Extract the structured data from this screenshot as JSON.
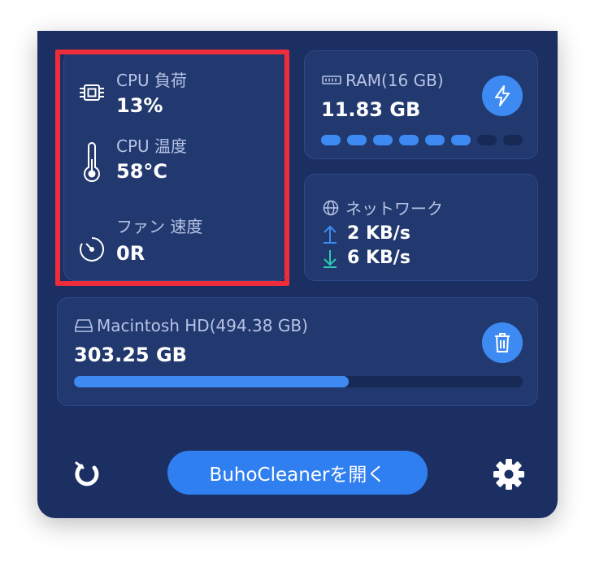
{
  "cpu_card": {
    "load_label": "CPU 負荷",
    "load_value": "13%",
    "temp_label": "CPU 温度",
    "temp_value": "58°C",
    "fan_label": "ファン 速度",
    "fan_value": "0R"
  },
  "ram_card": {
    "label": "RAM(16 GB)",
    "value": "11.83 GB",
    "usage_fraction": 0.74,
    "segments_total": 8,
    "segments_filled": 6
  },
  "network_card": {
    "label": "ネットワーク",
    "upload": "2 KB/s",
    "download": "6 KB/s"
  },
  "disk_card": {
    "label": "Macintosh HD(494.38 GB)",
    "value": "303.25 GB",
    "usage_fraction": 0.613
  },
  "footer": {
    "open_button_label": "BuhoCleanerを開く"
  },
  "icons": {
    "cpu": "cpu-chip-icon",
    "temperature": "thermometer-icon",
    "fan": "gauge-icon",
    "ram": "memory-module-icon",
    "boost": "lightning-icon",
    "network": "globe-icon",
    "upload": "arrow-up-icon",
    "download": "arrow-down-icon",
    "disk": "hard-drive-icon",
    "trash": "trash-icon",
    "logo": "buho-logo-icon",
    "settings": "gear-icon"
  },
  "colors": {
    "panel_bg": "#1c2f63",
    "card_bg": "#22396f",
    "accent": "#3d8bf2",
    "upload_arrow": "#3d8bf2",
    "download_arrow": "#2ec9b0",
    "highlight": "#ef2d3a",
    "segment_empty": "#172a55"
  }
}
